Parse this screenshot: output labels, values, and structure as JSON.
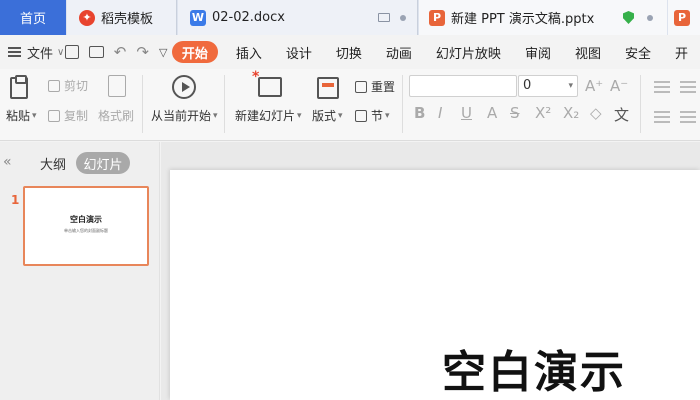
{
  "tabs": {
    "home": "首页",
    "templates": "稻壳模板",
    "docx": "02-02.docx",
    "pptx": "新建 PPT 演示文稿.pptx"
  },
  "menu": {
    "file": "文件",
    "items": [
      "开始",
      "插入",
      "设计",
      "切换",
      "动画",
      "幻灯片放映",
      "审阅",
      "视图",
      "安全",
      "开"
    ],
    "active": "开始"
  },
  "ribbon": {
    "paste": "粘贴",
    "cut": "剪切",
    "copy": "复制",
    "format_painter": "格式刷",
    "from_current": "从当前开始",
    "new_slide": "新建幻灯片",
    "layout": "版式",
    "reset": "重置",
    "section": "节",
    "font_size": "0"
  },
  "left_panel": {
    "outline_tab": "大纲",
    "slides_tab": "幻灯片",
    "slide_number": "1",
    "thumb_title": "空白演示",
    "thumb_subtitle": "单击输入您的封面副标题"
  },
  "slide": {
    "title": "空白演示"
  },
  "colors": {
    "accent": "#f06a3d",
    "home_tab": "#3b6fd9"
  }
}
